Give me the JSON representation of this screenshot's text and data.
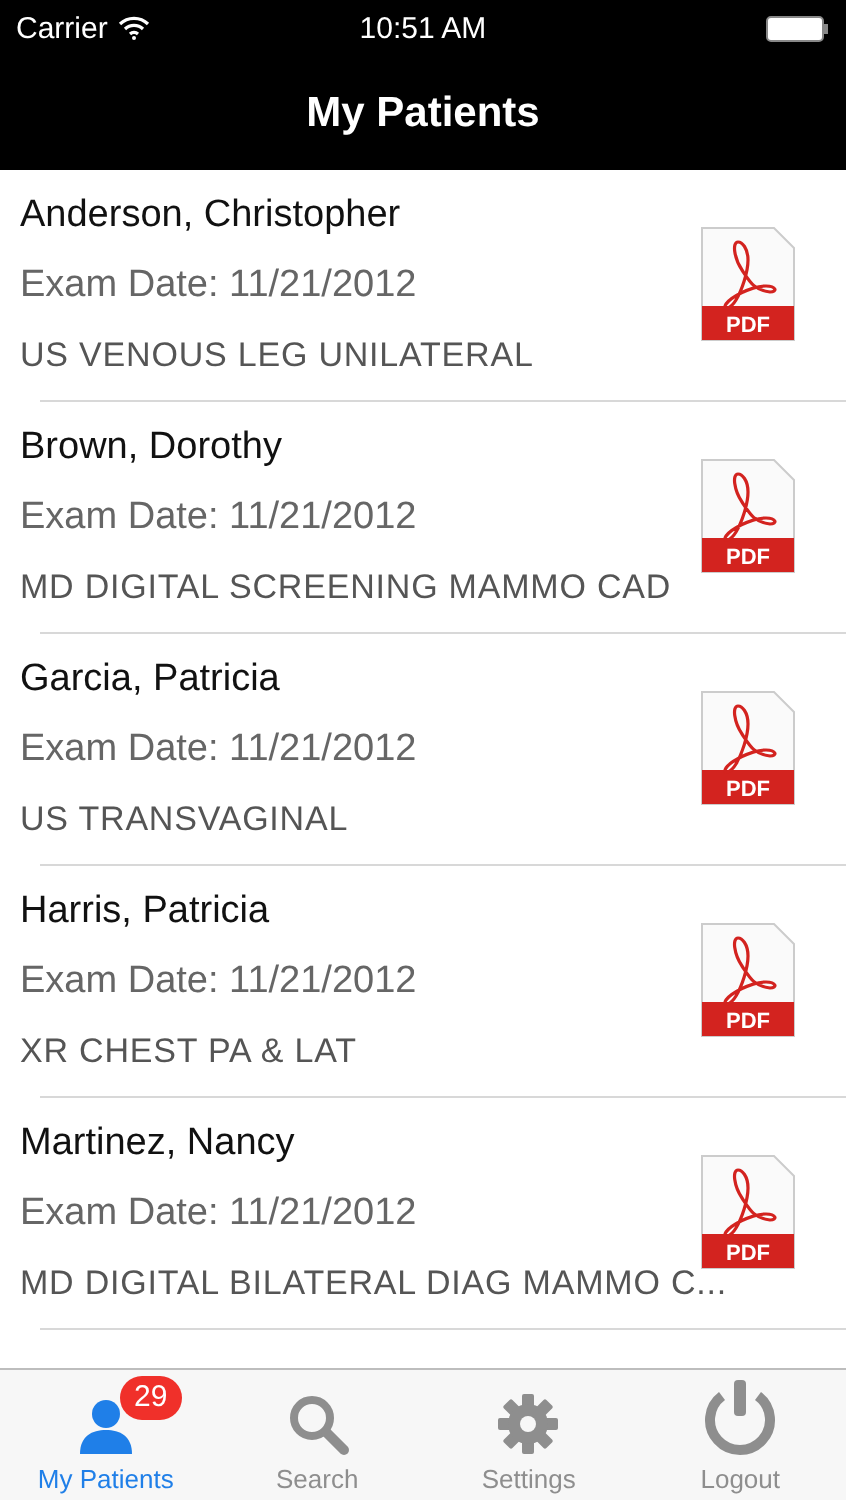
{
  "status_bar": {
    "carrier": "Carrier",
    "time": "10:51 AM"
  },
  "nav_bar": {
    "title": "My Patients"
  },
  "patients": [
    {
      "name": "Anderson, Christopher",
      "exam_date": "Exam Date: 11/21/2012",
      "procedure": "US VENOUS LEG UNILATERAL",
      "report_label": "PDF"
    },
    {
      "name": "Brown, Dorothy",
      "exam_date": "Exam Date: 11/21/2012",
      "procedure": "MD DIGITAL SCREENING MAMMO CAD",
      "report_label": "PDF"
    },
    {
      "name": "Garcia, Patricia",
      "exam_date": "Exam Date: 11/21/2012",
      "procedure": "US TRANSVAGINAL",
      "report_label": "PDF"
    },
    {
      "name": "Harris, Patricia",
      "exam_date": "Exam Date: 11/21/2012",
      "procedure": "XR CHEST PA & LAT",
      "report_label": "PDF"
    },
    {
      "name": "Martinez, Nancy",
      "exam_date": "Exam Date: 11/21/2012",
      "procedure": "MD DIGITAL BILATERAL DIAG MAMMO C...",
      "report_label": "PDF"
    }
  ],
  "tab_bar": [
    {
      "kind": "patients",
      "label": "My Patients",
      "selected": true,
      "badge": "29"
    },
    {
      "kind": "search",
      "label": "Search",
      "selected": false
    },
    {
      "kind": "settings",
      "label": "Settings",
      "selected": false
    },
    {
      "kind": "logout",
      "label": "Logout",
      "selected": false
    }
  ]
}
